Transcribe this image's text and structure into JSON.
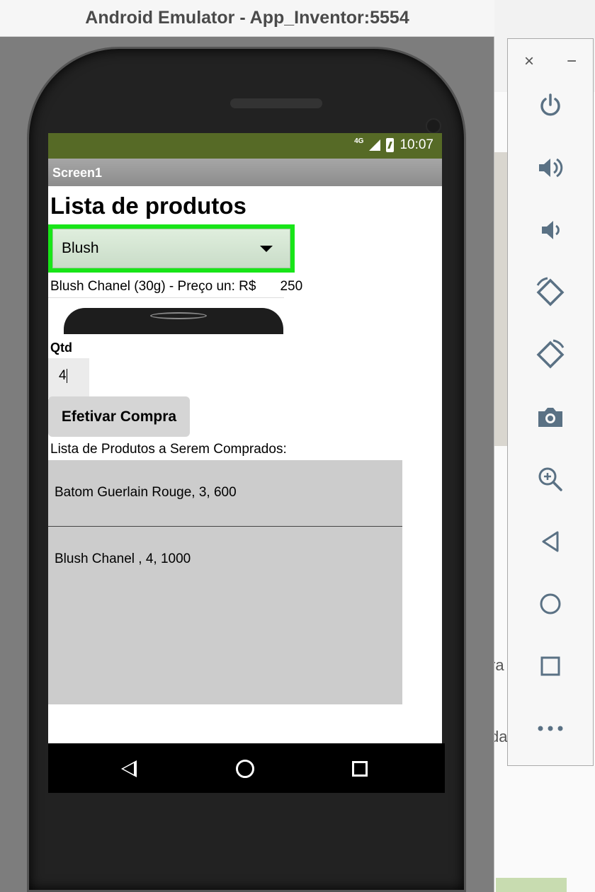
{
  "emulator": {
    "title": "Android Emulator - App_Inventor:5554"
  },
  "background_window": {
    "fragment_1": "ra",
    "fragment_2": "da"
  },
  "status_bar": {
    "network": "4G",
    "time": "10:07"
  },
  "app": {
    "screen_title": "Screen1",
    "heading": "Lista de produtos",
    "spinner": {
      "selected": "Blush"
    },
    "product_info": {
      "label": "Blush Chanel (30g) - Preço un: R$",
      "price": "250"
    },
    "quantity": {
      "label": "Qtd",
      "value": "4"
    },
    "buy_button": "Efetivar Compra",
    "list_title": "Lista de Produtos a Serem Comprados:",
    "list_items": [
      "Batom Guerlain Rouge, 3, 600",
      "Blush Chanel , 4, 1000"
    ]
  },
  "toolbar": {
    "close": "×",
    "minimize": "−",
    "buttons": [
      "power-icon",
      "volume-up-icon",
      "volume-down-icon",
      "rotate-left-icon",
      "rotate-right-icon",
      "camera-icon",
      "zoom-icon",
      "back-icon",
      "home-icon",
      "overview-icon",
      "more-icon"
    ]
  },
  "colors": {
    "status_bar": "#566a26",
    "spinner_border": "#18e518",
    "list_bg": "#cccccc",
    "toolbar_icon": "#5a7184"
  }
}
